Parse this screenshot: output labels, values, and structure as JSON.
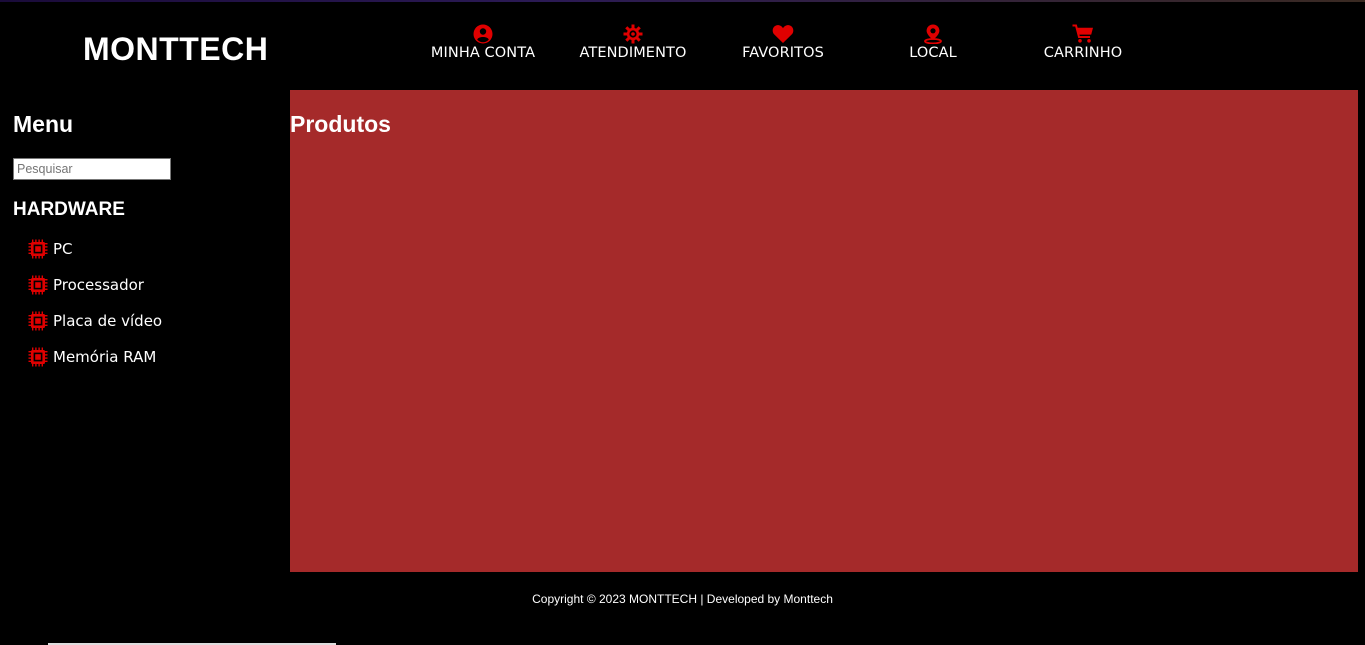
{
  "header": {
    "logo": "MONTTECH",
    "nav": [
      {
        "label": "MINHA CONTA",
        "icon": "user-circle-icon"
      },
      {
        "label": "ATENDIMENTO",
        "icon": "gear-icon"
      },
      {
        "label": "FAVORITOS",
        "icon": "heart-icon"
      },
      {
        "label": "LOCAL",
        "icon": "location-pin-icon"
      },
      {
        "label": "CARRINHO",
        "icon": "shopping-cart-icon"
      }
    ]
  },
  "sidebar": {
    "title": "Menu",
    "search": {
      "placeholder": "Pesquisar",
      "value": ""
    },
    "section_title": "HARDWARE",
    "items": [
      {
        "label": "PC",
        "icon": "chip-icon"
      },
      {
        "label": "Processador",
        "icon": "chip-icon"
      },
      {
        "label": "Placa de vídeo",
        "icon": "chip-icon"
      },
      {
        "label": "Memória RAM",
        "icon": "chip-icon"
      }
    ]
  },
  "main": {
    "title": "Produtos"
  },
  "footer": {
    "copyright": "Copyright © 2023 MONTTECH | Developed by Monttech"
  },
  "colors": {
    "accent": "#e00000",
    "content_bg": "#a52a2a",
    "page_bg": "#000000"
  }
}
